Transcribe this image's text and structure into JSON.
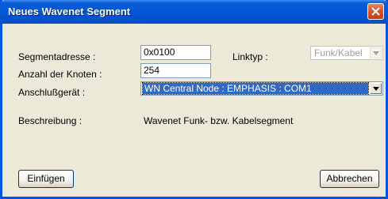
{
  "window": {
    "title": "Neues Wavenet Segment"
  },
  "form": {
    "segment_address_label": "Segmentadresse :",
    "segment_address_value": "0x0100",
    "linktype_label": "Linktyp :",
    "linktype_value": "Funk/Kabel",
    "node_count_label": "Anzahl der Knoten :",
    "node_count_value": "254",
    "device_label": "Anschlußgerät :",
    "device_value": "WN Central Node : EMPHASIS : COM1",
    "description_label": "Beschreibung :",
    "description_value": "Wavenet Funk- bzw. Kabelsegment"
  },
  "buttons": {
    "insert": "Einfügen",
    "cancel": "Abbrechen"
  },
  "colors": {
    "titlebar": "#0356d6",
    "selection": "#316ac5",
    "close": "#d8532b",
    "window_bg": "#ece9d8"
  }
}
